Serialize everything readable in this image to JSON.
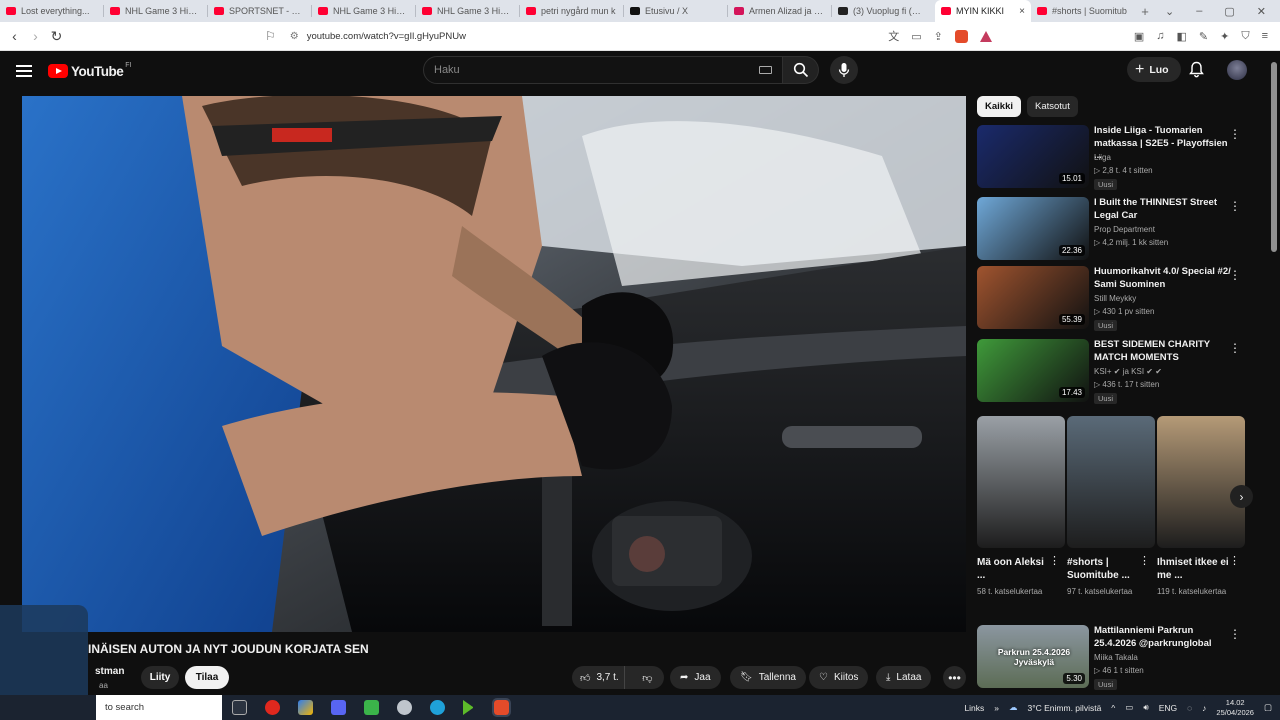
{
  "browser": {
    "tabs": [
      {
        "label": "Lost everything...",
        "color": "#ff0033"
      },
      {
        "label": "NHL Game 3 Highli",
        "color": "#ff0033"
      },
      {
        "label": "SPORTSNET - YouTu",
        "color": "#ff0033"
      },
      {
        "label": "NHL Game 3 Highli",
        "color": "#ff0033"
      },
      {
        "label": "NHL Game 3 Highli",
        "color": "#ff0033"
      },
      {
        "label": "petri nygård mun k",
        "color": "#ff0033"
      },
      {
        "label": "Etusivu / X",
        "color": "#111111"
      },
      {
        "label": "Armen Alizad ja Se",
        "color": "#d4145a"
      },
      {
        "label": "(3) Vuoplug fi (@vu",
        "color": "#222222"
      },
      {
        "label": "MYIN KIKKI",
        "color": "#ff0033",
        "active": true
      },
      {
        "label": "#shorts | Suomitub",
        "color": "#ff0033"
      }
    ],
    "url": "youtube.com/watch?v=gIl.gHyuPNUw"
  },
  "youtube": {
    "logo_text": "YouTube",
    "logo_region": "FI",
    "search_placeholder": "Haku",
    "create_label": "Luo"
  },
  "video": {
    "title": "INÄISEN AUTON JA NYT JOUDUN KORJATA SEN",
    "channel": "stman",
    "channel_sub": "aa",
    "join_label": "Liity",
    "subscribe_label": "Tilaa",
    "likes": "3,7 t.",
    "share_label": "Jaa",
    "save_label": "Tallenna",
    "thanks_label": "Kiitos",
    "download_label": "Lataa"
  },
  "chips": [
    "Kaikki",
    "Katsotut"
  ],
  "recommendations": [
    {
      "title": "Inside Liiga - Tuomarien matkassa | S2E5 - Playoffsien ...",
      "channel": "Liiga",
      "stats": "▷ 2,8 t.   4 t sitten",
      "badge": "Uusi",
      "duration": "15.01",
      "thumb": "#1a2a6c"
    },
    {
      "title": "I Built the THINNEST Street Legal Car",
      "channel": "Prop Department",
      "stats": "▷ 4,2 milj.   1 kk sitten",
      "badge": "",
      "duration": "22.36",
      "thumb": "#6fa8d8"
    },
    {
      "title": "Huumorikahvit 4.0/ Special #2/ Sami Suominen",
      "channel": "Still Meykky",
      "stats": "▷ 430   1 pv sitten",
      "badge": "Uusi",
      "duration": "55.39",
      "thumb": "#a0542f"
    },
    {
      "title": "BEST SIDEMEN CHARITY MATCH MOMENTS",
      "channel": "KSI+ ✔ ja KSI ✔ ✔",
      "stats": "▷ 436 t.   17 t sitten",
      "badge": "Uusi",
      "duration": "17.43",
      "thumb": "#3f9a3a"
    }
  ],
  "shorts": [
    {
      "title": "Mä oon Aleksi ...",
      "views": "58 t. katselukertaa",
      "thumb": "#9aa0a6"
    },
    {
      "title": "#shorts | Suomitube ...",
      "views": "97 t. katselukertaa",
      "thumb": "#5a6a78"
    },
    {
      "title": "Ihmiset itkee ei me ...",
      "views": "119 t. katselukertaa",
      "thumb": "#b59a77"
    }
  ],
  "last_rec": {
    "title": "Mattilanniemi Parkrun 25.4.2026 @parkrunglobal",
    "channel": "Miika Takala",
    "stats": "▷ 46   1 t sitten",
    "badge": "Uusi",
    "duration": "5.30",
    "thumb": "#7c8a72",
    "thumb_text": "Parkrun 25.4.2026 Jyväskylä"
  },
  "taskbar": {
    "search": "to search",
    "links": "Links",
    "weather": "3°C  Enimm. pilvistä",
    "lang": "ENG",
    "time": "14.02",
    "date": "25/04/2026"
  }
}
